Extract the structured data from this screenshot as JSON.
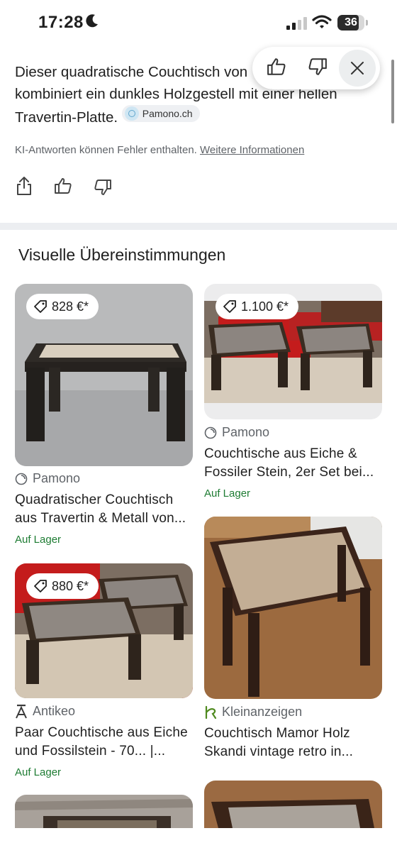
{
  "status_bar": {
    "time": "17:28",
    "battery": "36"
  },
  "ai_answer": {
    "line1": "Dieser quadratische Couchtisch von",
    "line2": "kombiniert ein dunkles Holzgestell mit einer hellen",
    "line3": "Travertin-Platte.",
    "source_chip": "Pamono.ch",
    "disclaimer": "KI-Antworten können Fehler enthalten.",
    "more_info_link": "Weitere Informationen"
  },
  "section_title": "Visuelle Übereinstimmungen",
  "colors": {
    "in_stock_green": "#1e7c33",
    "divider": "#eceef1",
    "chip_bg": "#eef0f3"
  },
  "cards": [
    {
      "price": "828 €*",
      "source": "Pamono",
      "source_icon": "circle-logo-icon",
      "title1": "Quadratischer Couchtisch",
      "title2": "aus Travertin & Metall von...",
      "stock": "Auf Lager"
    },
    {
      "price": "1.100 €*",
      "source": "Pamono",
      "source_icon": "circle-logo-icon",
      "title1": "Couchtische aus Eiche &",
      "title2": "Fossiler Stein, 2er Set bei...",
      "stock": "Auf Lager"
    },
    {
      "price": "880 €*",
      "source": "Antikeo",
      "source_icon": "antikeo-logo-icon",
      "title1": "Paar Couchtische aus Eiche",
      "title2": "und Fossilstein - 70... |...",
      "stock": "Auf Lager"
    },
    {
      "price": "",
      "source": "Kleinanzeigen",
      "source_icon": "kleinanzeigen-logo-icon",
      "title1": "Couchtisch Mamor Holz",
      "title2": "Skandi vintage retro in...",
      "stock": ""
    }
  ]
}
